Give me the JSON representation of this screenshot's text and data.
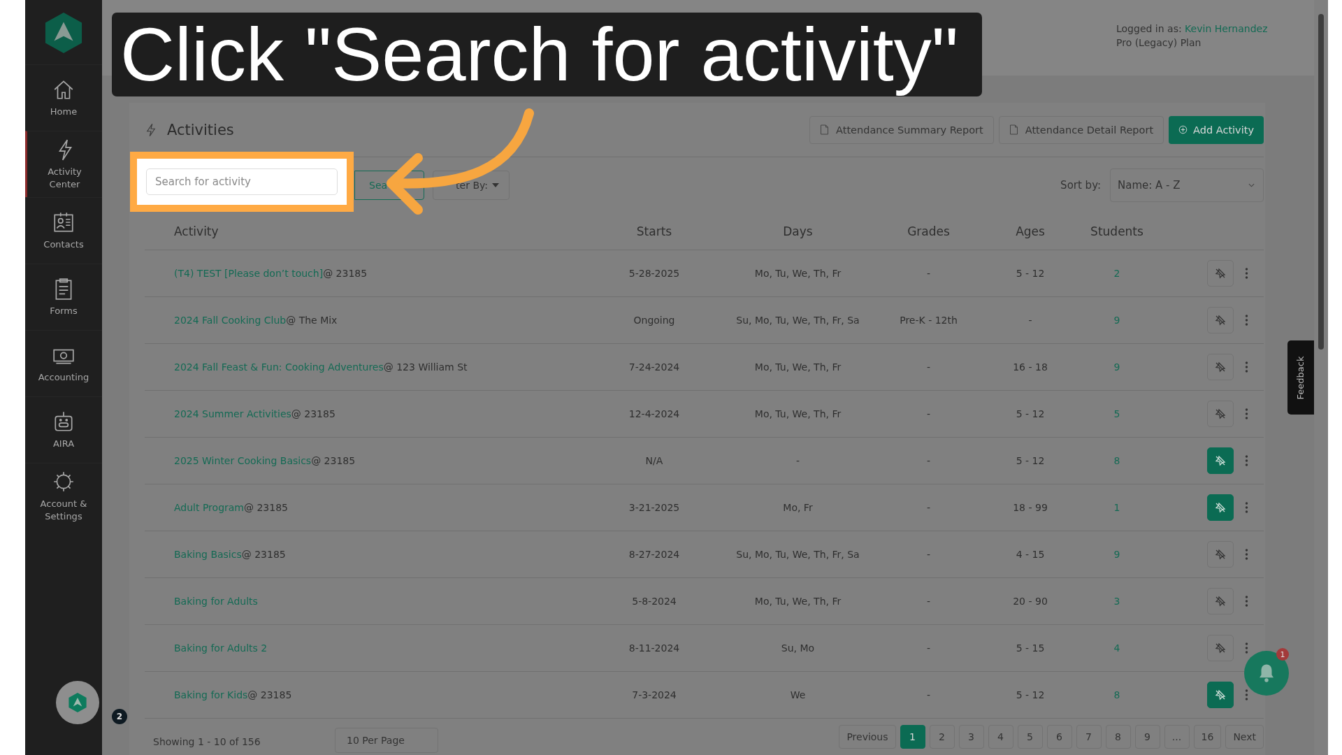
{
  "callout": {
    "text": "Click \"Search for activity\""
  },
  "sidebar": {
    "items": [
      {
        "label": "Home",
        "selected": false
      },
      {
        "label": "Activity Center",
        "selected": true
      },
      {
        "label": "Contacts",
        "selected": false
      },
      {
        "label": "Forms",
        "selected": false
      },
      {
        "label": "Accounting",
        "selected": false
      },
      {
        "label": "AIRA",
        "selected": false
      },
      {
        "label": "Account & Settings",
        "selected": false
      }
    ],
    "account_badge": "2"
  },
  "header": {
    "logged_in_label": "Logged in as:",
    "user": "Kevin Hernandez",
    "plan": "Pro (Legacy) Plan"
  },
  "activities": {
    "title": "Activities",
    "report_buttons": [
      "Attendance Summary Report",
      "Attendance Detail Report"
    ],
    "add_button": "Add Activity",
    "search": {
      "placeholder": "Search for activity"
    },
    "search_button": "Sea",
    "filter_button": "ter By:",
    "sort_label": "Sort by:",
    "sort_value": "Name: A - Z"
  },
  "table": {
    "columns": [
      "Activity",
      "Starts",
      "Days",
      "Grades",
      "Ages",
      "Students"
    ],
    "rows": [
      {
        "name": "(T4) TEST [Please don’t touch]",
        "location": "@ 23185",
        "starts": "5-28-2025",
        "days": "Mo, Tu, We, Th, Fr",
        "grades": "-",
        "ages": "5 - 12",
        "students": "2",
        "pinned": false
      },
      {
        "name": "2024 Fall Cooking Club",
        "location": "@ The Mix",
        "starts": "Ongoing",
        "days": "Su, Mo, Tu, We, Th, Fr, Sa",
        "grades": "Pre-K - 12th",
        "ages": "-",
        "students": "9",
        "pinned": false
      },
      {
        "name": "2024 Fall Feast & Fun: Cooking Adventures",
        "location": "@ 123 William St",
        "starts": "7-24-2024",
        "days": "Mo, Tu, We, Th, Fr",
        "grades": "-",
        "ages": "16 - 18",
        "students": "9",
        "pinned": false
      },
      {
        "name": "2024 Summer Activities",
        "location": "@ 23185",
        "starts": "12-4-2024",
        "days": "Mo, Tu, We, Th, Fr",
        "grades": "-",
        "ages": "5 - 12",
        "students": "5",
        "pinned": false
      },
      {
        "name": "2025 Winter Cooking Basics",
        "location": "@ 23185",
        "starts": "N/A",
        "days": "-",
        "grades": "-",
        "ages": "5 - 12",
        "students": "8",
        "pinned": true
      },
      {
        "name": "Adult Program",
        "location": "@ 23185",
        "starts": "3-21-2025",
        "days": "Mo, Fr",
        "grades": "-",
        "ages": "18 - 99",
        "students": "1",
        "pinned": true
      },
      {
        "name": "Baking Basics",
        "location": "@ 23185",
        "starts": "8-27-2024",
        "days": "Su, Mo, Tu, We, Th, Fr, Sa",
        "grades": "-",
        "ages": "4 - 15",
        "students": "9",
        "pinned": false
      },
      {
        "name": "Baking for Adults",
        "starts": "5-8-2024",
        "days": "Mo, Tu, We, Th, Fr",
        "grades": "-",
        "ages": "20 - 90",
        "students": "3",
        "pinned": false
      },
      {
        "name": "Baking for Adults 2",
        "starts": "8-11-2024",
        "days": "Su, Mo",
        "grades": "-",
        "ages": "5 - 15",
        "students": "4",
        "pinned": false
      },
      {
        "name": "Baking for Kids",
        "location": "@ 23185",
        "starts": "7-3-2024",
        "days": "We",
        "grades": "-",
        "ages": "5 - 12",
        "students": "8",
        "pinned": true
      }
    ]
  },
  "footer": {
    "showing": "Showing 1 - 10 of 156",
    "per_page": "10 Per Page",
    "pagination": [
      {
        "label": "Previous",
        "selected": false
      },
      {
        "label": "1",
        "selected": true
      },
      {
        "label": "2",
        "selected": false
      },
      {
        "label": "3",
        "selected": false
      },
      {
        "label": "4",
        "selected": false
      },
      {
        "label": "5",
        "selected": false
      },
      {
        "label": "6",
        "selected": false
      },
      {
        "label": "7",
        "selected": false
      },
      {
        "label": "8",
        "selected": false
      },
      {
        "label": "9",
        "selected": false
      },
      {
        "label": "...",
        "selected": false
      },
      {
        "label": "16",
        "selected": false
      },
      {
        "label": "Next",
        "selected": false
      }
    ]
  },
  "feedback": "Feedback",
  "notifications": {
    "badge": "1"
  }
}
